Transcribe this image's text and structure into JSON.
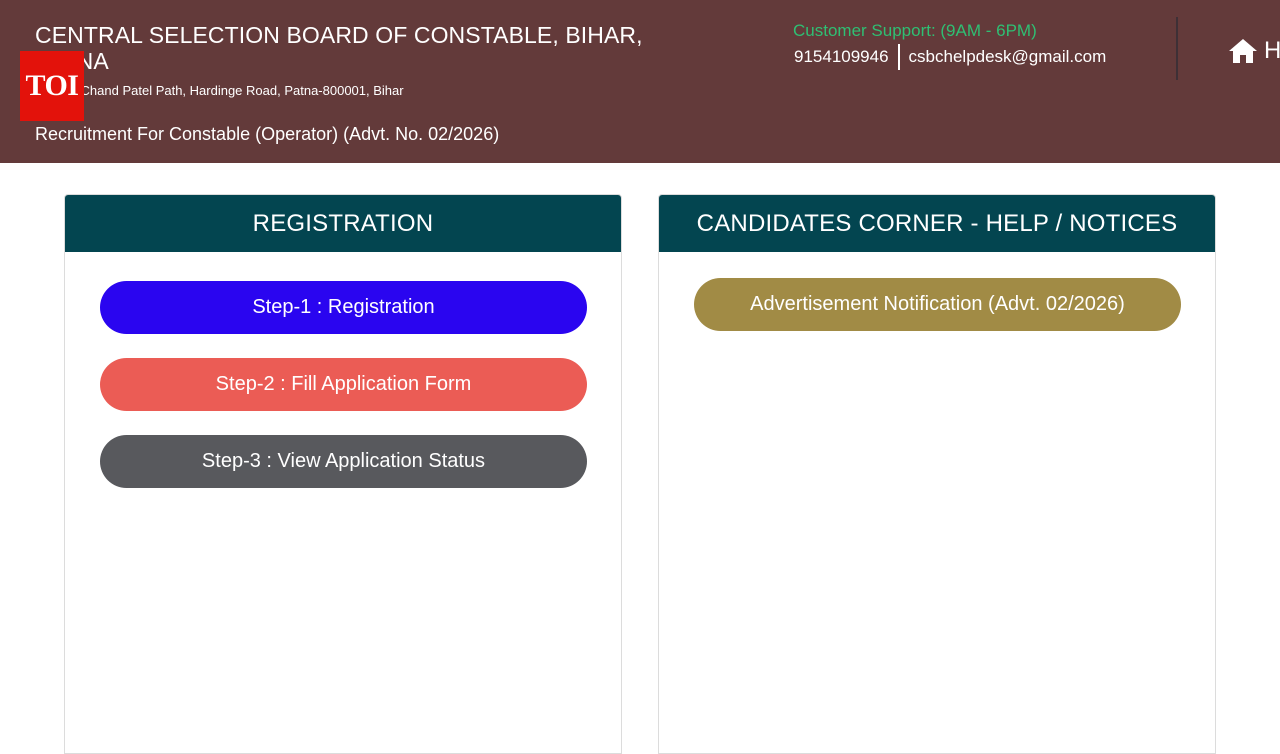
{
  "header": {
    "org_name": "CENTRAL SELECTION BOARD OF CONSTABLE, BIHAR, PATNA",
    "address": "6, Beer Chand Patel Path, Hardinge Road, Patna-800001, Bihar",
    "recruitment_title": "Recruitment For Constable (Operator) (Advt. No. 02/2026)",
    "support_label": "Customer Support: (9AM - 6PM)",
    "phone": "9154109946",
    "email": "csbchelpdesk@gmail.com",
    "home_label": "Home",
    "home_icon": "home-icon",
    "background_color": "#633a3a",
    "support_color": "#2fbf73"
  },
  "watermark": {
    "text": "TOI",
    "color": "#e3120b"
  },
  "registration": {
    "title": "REGISTRATION",
    "header_color": "#034550",
    "steps": [
      {
        "label": "Step-1 : Registration",
        "color": "#2a05f0"
      },
      {
        "label": "Step-2 : Fill Application Form",
        "color": "#eb5c55"
      },
      {
        "label": "Step-3 : View Application Status",
        "color": "#58595d"
      }
    ]
  },
  "candidates_corner": {
    "title": "CANDIDATES CORNER - HELP / NOTICES",
    "header_color": "#034550",
    "links": [
      {
        "label": "Advertisement Notification (Advt. 02/2026)",
        "color": "#a18b45"
      }
    ]
  }
}
